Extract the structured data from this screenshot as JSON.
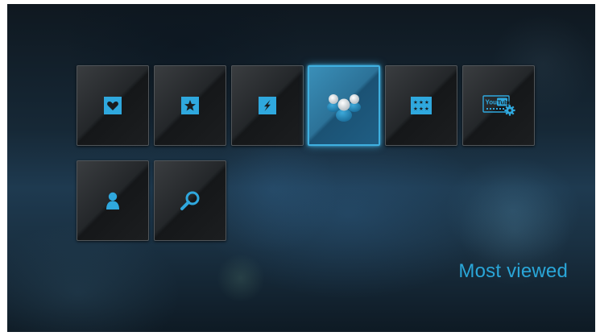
{
  "menu": {
    "items": [
      {
        "name": "favorites",
        "icon": "heart-icon"
      },
      {
        "name": "featured",
        "icon": "star-icon"
      },
      {
        "name": "top-rated",
        "icon": "lightning-icon"
      },
      {
        "name": "most-viewed",
        "icon": "users-group-icon",
        "selected": true
      },
      {
        "name": "most-popular",
        "icon": "stars-grid-icon"
      },
      {
        "name": "youtube-settings",
        "icon": "youtube-gear-icon"
      },
      {
        "name": "my-account",
        "icon": "person-icon"
      },
      {
        "name": "search",
        "icon": "search-icon"
      }
    ],
    "selected_label": "Most viewed"
  },
  "youtube_logo": {
    "you": "You",
    "tube": "Tube"
  },
  "colors": {
    "accent": "#2aa6d8",
    "icon_fill": "#2fa8de",
    "tile_dark": "#1c1e20",
    "tile_selected": "#2c7298"
  }
}
